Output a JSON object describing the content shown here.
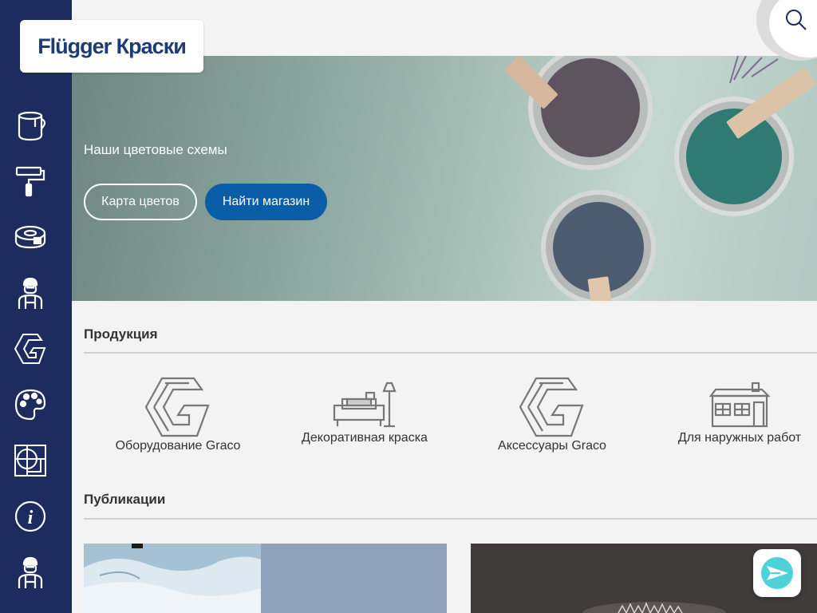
{
  "logo": {
    "text": "Flügger Краски"
  },
  "sidebar": {
    "items": [
      {
        "icon": "paint-bucket-icon"
      },
      {
        "icon": "paint-roller-icon"
      },
      {
        "icon": "tape-roll-icon"
      },
      {
        "icon": "painter-icon"
      },
      {
        "icon": "graco-icon"
      },
      {
        "icon": "palette-icon"
      },
      {
        "icon": "pattern-icon"
      },
      {
        "icon": "info-icon"
      },
      {
        "icon": "painter-icon"
      }
    ]
  },
  "hero": {
    "title": "Наши цветовые схемы",
    "button_colors": "Карта цветов",
    "button_store": "Найти магазин"
  },
  "products": {
    "title": "Продукция",
    "items": [
      {
        "label": "Оборудование Graco",
        "icon": "graco-icon"
      },
      {
        "label": "Декоративная краска",
        "icon": "furniture-icon"
      },
      {
        "label": "Аксессуары Graco",
        "icon": "graco-icon"
      },
      {
        "label": "Для наружных работ",
        "icon": "house-icon"
      }
    ]
  },
  "publications": {
    "title": "Публикации"
  },
  "colors": {
    "sidebar": "#1d2b5e",
    "brand_blue": "#0a5ea8",
    "logo_text": "#1d3b75"
  }
}
